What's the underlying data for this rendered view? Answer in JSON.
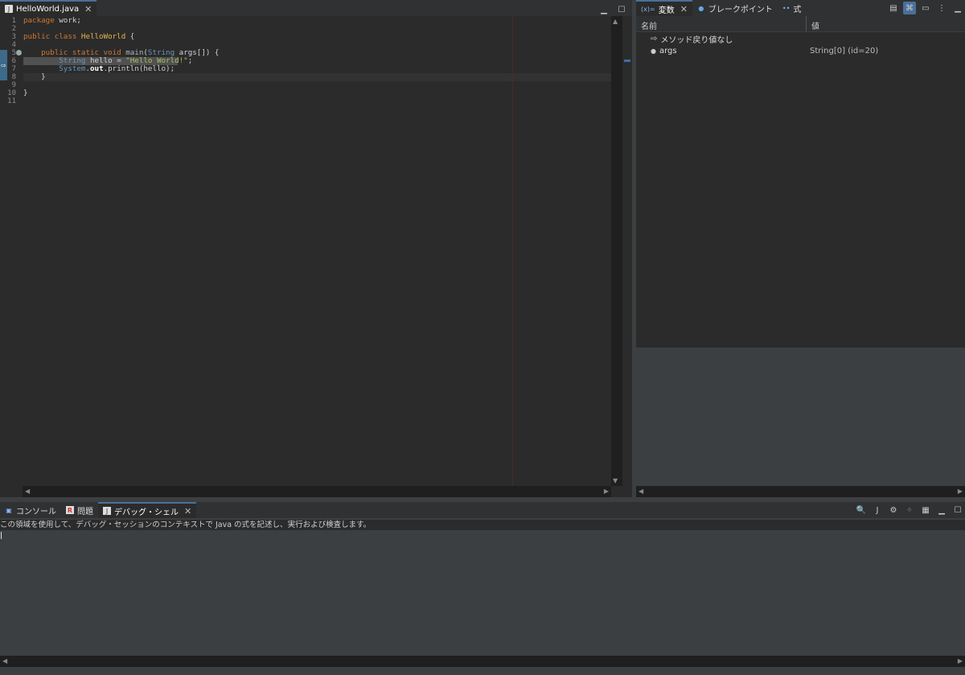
{
  "editor": {
    "tab_label": "HelloWorld.java",
    "line_numbers": [
      "1",
      "2",
      "3",
      "4",
      "5",
      "6",
      "7",
      "8",
      "9",
      "10",
      "11"
    ],
    "lines": [
      [
        {
          "t": "package ",
          "c": "kw"
        },
        {
          "t": "work;",
          "c": "plain"
        }
      ],
      [],
      [
        {
          "t": "public class ",
          "c": "kw"
        },
        {
          "t": "HelloWorld",
          "c": "cls"
        },
        {
          "t": " {",
          "c": "plain"
        }
      ],
      [],
      [
        {
          "t": "    public static void ",
          "c": "kw"
        },
        {
          "t": "main",
          "c": "fn"
        },
        {
          "t": "(",
          "c": "plain"
        },
        {
          "t": "String ",
          "c": "ty"
        },
        {
          "t": "args",
          "c": "plain"
        },
        {
          "t": "[]) {",
          "c": "plain"
        }
      ],
      [
        {
          "t": "        String ",
          "c": "ty"
        },
        {
          "t": "hello",
          "c": "plain"
        },
        {
          "t": " = ",
          "c": "plain"
        },
        {
          "t": "\"Hello World!\"",
          "c": "str"
        },
        {
          "t": ";",
          "c": "plain"
        }
      ],
      [
        {
          "t": "        System",
          "c": "ty"
        },
        {
          "t": ".",
          "c": "plain"
        },
        {
          "t": "out",
          "c": "fld"
        },
        {
          "t": ".println(hello);",
          "c": "plain"
        }
      ],
      [
        {
          "t": "    }",
          "c": "plain"
        }
      ],
      [],
      [
        {
          "t": "}",
          "c": "plain"
        }
      ],
      []
    ]
  },
  "variables": {
    "tabs": [
      {
        "label": "変数",
        "icon": "(x)="
      },
      {
        "label": "ブレークポイント",
        "icon": "●"
      },
      {
        "label": "式",
        "icon": "••"
      }
    ],
    "columns": {
      "name": "名前",
      "value": "値"
    },
    "rows": [
      {
        "name": "メソッド戻り値なし",
        "value": "",
        "icon": "⇨"
      },
      {
        "name": "args",
        "value": "String[0]  (id=20)",
        "icon": "●"
      }
    ]
  },
  "bottom": {
    "tabs": [
      {
        "label": "コンソール",
        "icon": "▣"
      },
      {
        "label": "問題",
        "icon": "R"
      },
      {
        "label": "デバッグ・シェル",
        "icon": "J"
      }
    ],
    "hint": "この領域を使用して、デバッグ・セッションのコンテキストで Java の式を記述し、実行および検査します。"
  },
  "colors": {
    "keyword": "#cc7832",
    "type": "#6897bb",
    "class": "#e6b450",
    "string": "#a5c261",
    "background": "#2b2b2b",
    "panel": "#3c3f41"
  }
}
